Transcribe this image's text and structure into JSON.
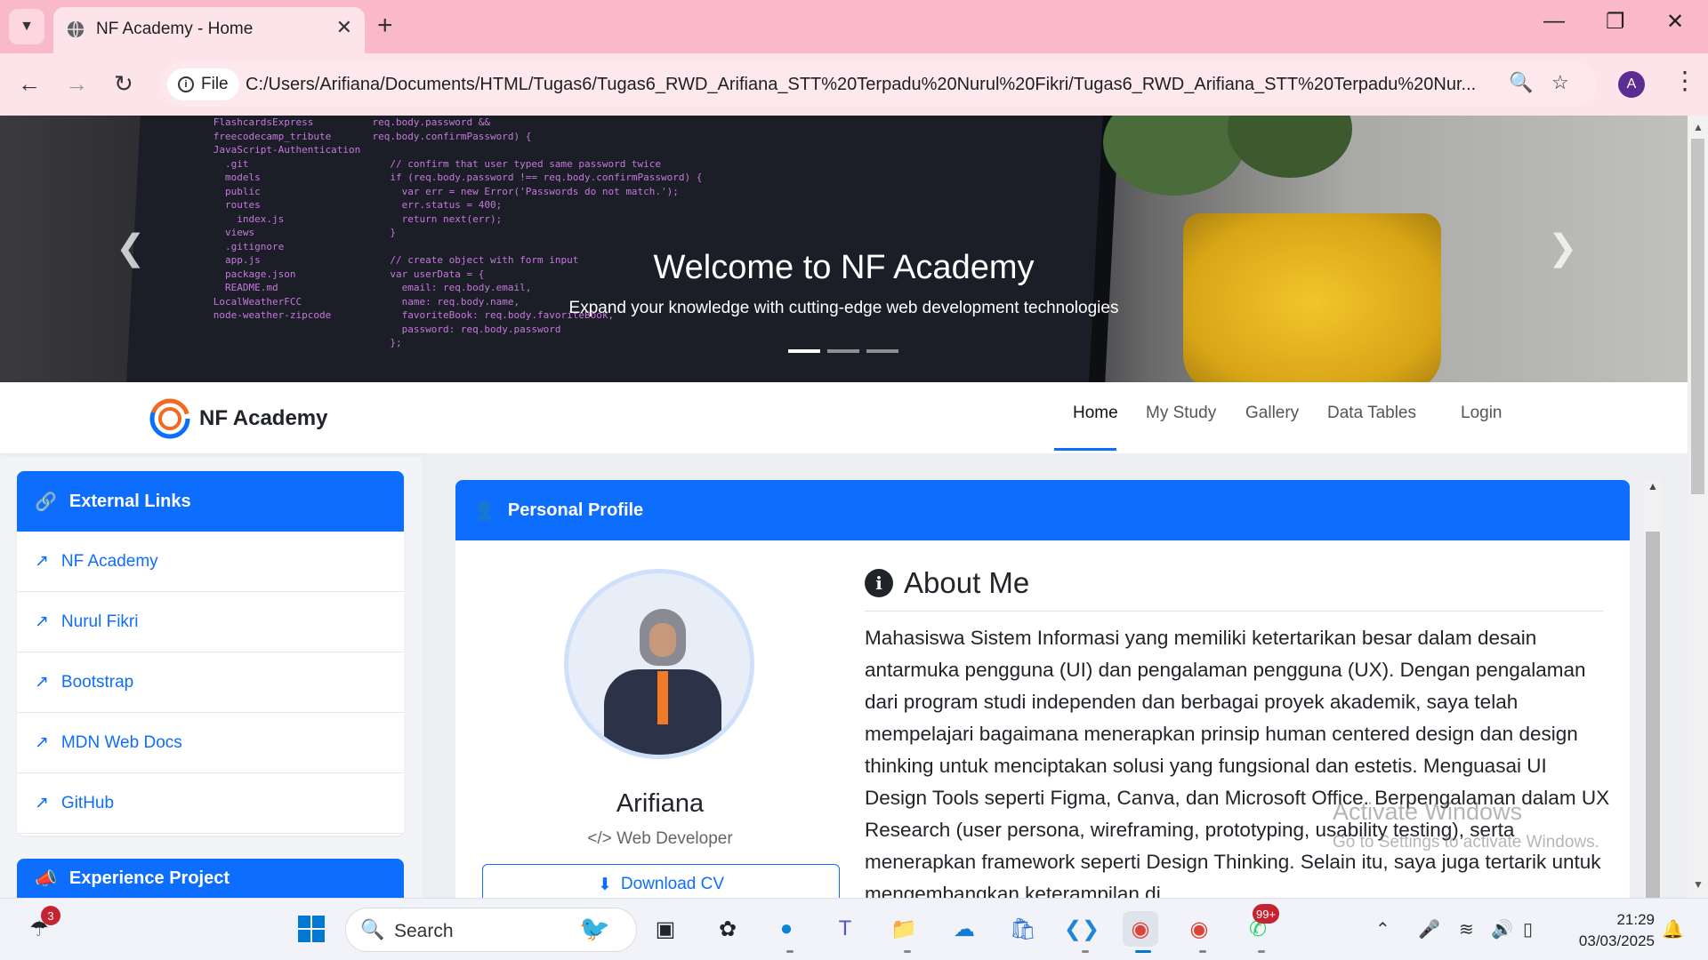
{
  "browser": {
    "tab_title": "NF Academy - Home",
    "file_label": "File",
    "url": "C:/Users/Arifiana/Documents/HTML/Tugas6/Tugas6_RWD_Arifiana_STT%20Terpadu%20Nurul%20Fikri/Tugas6_RWD_Arifiana_STT%20Terpadu%20Nur...",
    "profile_initial": "A"
  },
  "hero": {
    "title": "Welcome to NF Academy",
    "subtitle": "Expand your knowledge with cutting-edge web development technologies",
    "slides_total": 3,
    "active_slide": 1
  },
  "navbar": {
    "brand": "NF Academy",
    "links": [
      "Home",
      "My Study",
      "Gallery",
      "Data Tables",
      "Login"
    ],
    "active": "Home"
  },
  "sidebar": {
    "external_links_title": "External Links",
    "links": [
      "NF Academy",
      "Nurul Fikri",
      "Bootstrap",
      "MDN Web Docs",
      "GitHub"
    ],
    "experience_title": "Experience Project"
  },
  "profile": {
    "card_title": "Personal Profile",
    "name": "Arifiana",
    "role": "Web Developer",
    "download_label": "Download CV",
    "about_title": "About Me",
    "about_text": "Mahasiswa Sistem Informasi yang memiliki ketertarikan besar dalam desain antarmuka pengguna (UI) dan pengalaman pengguna (UX). Dengan pengalaman dari program studi independen dan berbagai proyek akademik, saya telah mempelajari bagaimana menerapkan prinsip human centered design dan design thinking untuk menciptakan solusi yang fungsional dan estetis. Menguasai UI Design Tools seperti Figma, Canva, dan Microsoft Office. Berpengalaman dalam UX Research (user persona, wireframing, prototyping, usability testing), serta menerapkan framework seperti Design Thinking. Selain itu, saya juga tertarik untuk mengembangkan keterampilan di"
  },
  "watermark": {
    "line1": "Activate Windows",
    "line2": "Go to Settings to activate Windows."
  },
  "taskbar": {
    "search_label": "Search",
    "weather_badge": "3",
    "whatsapp_badge": "99+",
    "time": "21:29",
    "date": "03/03/2025"
  },
  "colors": {
    "primary": "#0d6efd",
    "chrome_tabbar": "#f9b9c8",
    "chrome_addrbar": "#fde4ea"
  }
}
